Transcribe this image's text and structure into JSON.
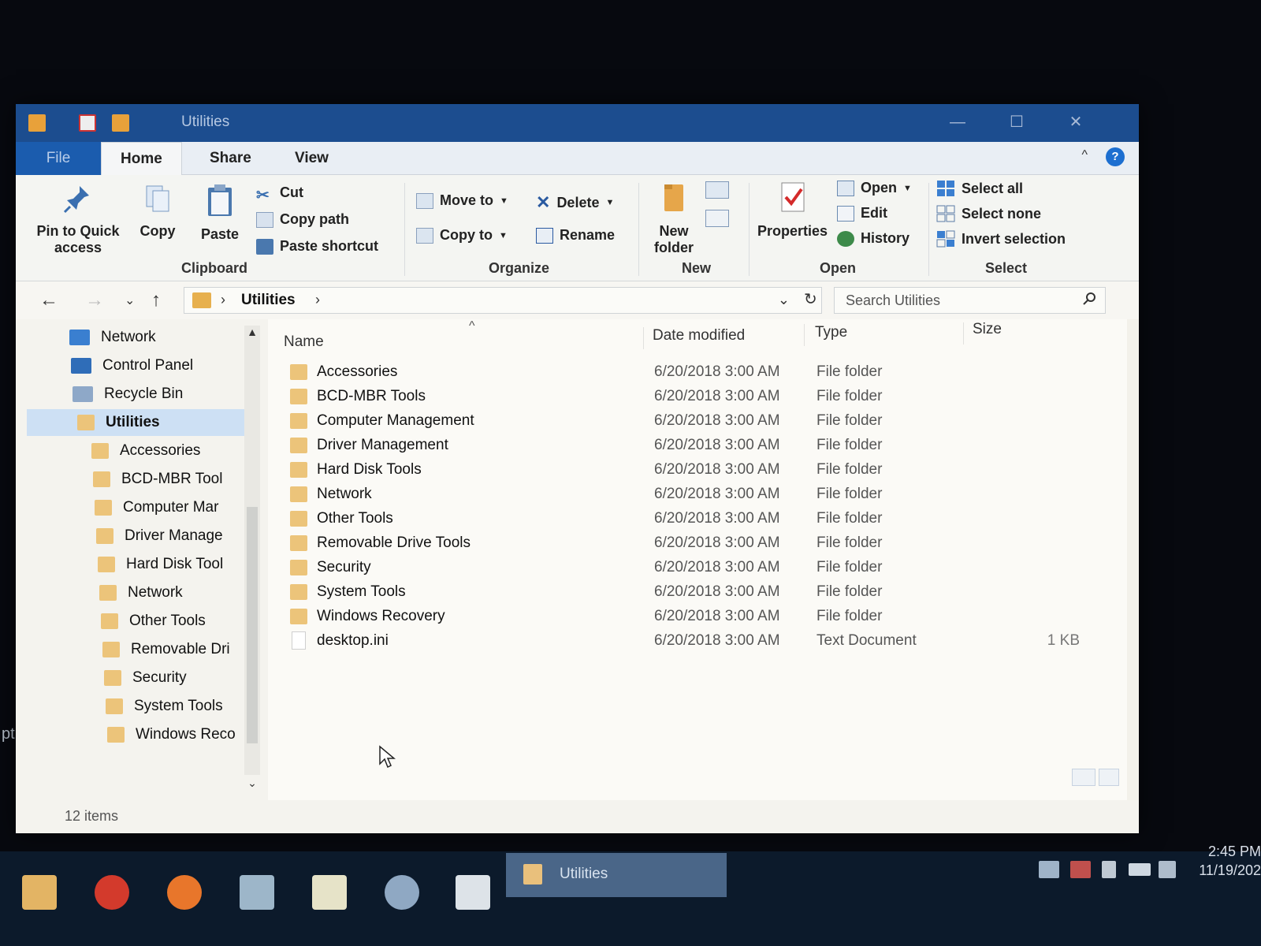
{
  "desktop": {
    "edge_text": "pt"
  },
  "window": {
    "title": "Utilities",
    "controls": {
      "minimize": "—",
      "maximize": "☐",
      "close": "✕"
    }
  },
  "tabs": [
    "File",
    "Home",
    "Share",
    "View"
  ],
  "ribbon": {
    "clipboard": {
      "label": "Clipboard",
      "pin": "Pin to Quick access",
      "copy": "Copy",
      "paste": "Paste",
      "cut": "Cut",
      "copy_path": "Copy path",
      "paste_shortcut": "Paste shortcut"
    },
    "organize": {
      "label": "Organize",
      "move_to": "Move to",
      "copy_to": "Copy to",
      "delete": "Delete",
      "rename": "Rename"
    },
    "new": {
      "label": "New",
      "new_folder": "New folder"
    },
    "open": {
      "label": "Open",
      "properties": "Properties",
      "open": "Open",
      "edit": "Edit",
      "history": "History"
    },
    "select": {
      "label": "Select",
      "select_all": "Select all",
      "select_none": "Select none",
      "invert": "Invert selection"
    }
  },
  "address": {
    "path": "Utilities",
    "search_placeholder": "Search Utilities"
  },
  "nav_pane": {
    "items": [
      {
        "label": "Network",
        "kind": "network"
      },
      {
        "label": "Control Panel",
        "kind": "control-panel"
      },
      {
        "label": "Recycle Bin",
        "kind": "recycle-bin"
      },
      {
        "label": "Utilities",
        "kind": "folder",
        "selected": true
      },
      {
        "label": "Accessories",
        "kind": "folder"
      },
      {
        "label": "BCD-MBR Tool",
        "kind": "folder"
      },
      {
        "label": "Computer Mar",
        "kind": "folder"
      },
      {
        "label": "Driver Manage",
        "kind": "folder"
      },
      {
        "label": "Hard Disk Tool",
        "kind": "folder"
      },
      {
        "label": "Network",
        "kind": "folder"
      },
      {
        "label": "Other Tools",
        "kind": "folder"
      },
      {
        "label": "Removable Dri",
        "kind": "folder"
      },
      {
        "label": "Security",
        "kind": "folder"
      },
      {
        "label": "System Tools",
        "kind": "folder"
      },
      {
        "label": "Windows Reco",
        "kind": "folder"
      }
    ]
  },
  "file_list": {
    "columns": [
      "Name",
      "Date modified",
      "Type",
      "Size"
    ],
    "rows": [
      {
        "name": "Accessories",
        "date": "6/20/2018 3:00 AM",
        "type": "File folder",
        "size": "",
        "kind": "folder"
      },
      {
        "name": "BCD-MBR Tools",
        "date": "6/20/2018 3:00 AM",
        "type": "File folder",
        "size": "",
        "kind": "folder"
      },
      {
        "name": "Computer Management",
        "date": "6/20/2018 3:00 AM",
        "type": "File folder",
        "size": "",
        "kind": "folder"
      },
      {
        "name": "Driver Management",
        "date": "6/20/2018 3:00 AM",
        "type": "File folder",
        "size": "",
        "kind": "folder"
      },
      {
        "name": "Hard Disk Tools",
        "date": "6/20/2018 3:00 AM",
        "type": "File folder",
        "size": "",
        "kind": "folder"
      },
      {
        "name": "Network",
        "date": "6/20/2018 3:00 AM",
        "type": "File folder",
        "size": "",
        "kind": "folder"
      },
      {
        "name": "Other Tools",
        "date": "6/20/2018 3:00 AM",
        "type": "File folder",
        "size": "",
        "kind": "folder"
      },
      {
        "name": "Removable Drive Tools",
        "date": "6/20/2018 3:00 AM",
        "type": "File folder",
        "size": "",
        "kind": "folder"
      },
      {
        "name": "Security",
        "date": "6/20/2018 3:00 AM",
        "type": "File folder",
        "size": "",
        "kind": "folder"
      },
      {
        "name": "System Tools",
        "date": "6/20/2018 3:00 AM",
        "type": "File folder",
        "size": "",
        "kind": "folder"
      },
      {
        "name": "Windows Recovery",
        "date": "6/20/2018 3:00 AM",
        "type": "File folder",
        "size": "",
        "kind": "folder"
      },
      {
        "name": "desktop.ini",
        "date": "6/20/2018 3:00 AM",
        "type": "Text Document",
        "size": "1 KB",
        "kind": "file"
      }
    ]
  },
  "status": {
    "items": "12 items"
  },
  "taskbar": {
    "active_window": "Utilities",
    "clock_time": "2:45 PM",
    "clock_date": "11/19/202"
  },
  "colors": {
    "titlebar": "#1c4d8f",
    "file_tab": "#1b5cae",
    "selection": "#cde0f4",
    "folder": "#ecc47a",
    "taskbar": "#0c1a2b"
  }
}
